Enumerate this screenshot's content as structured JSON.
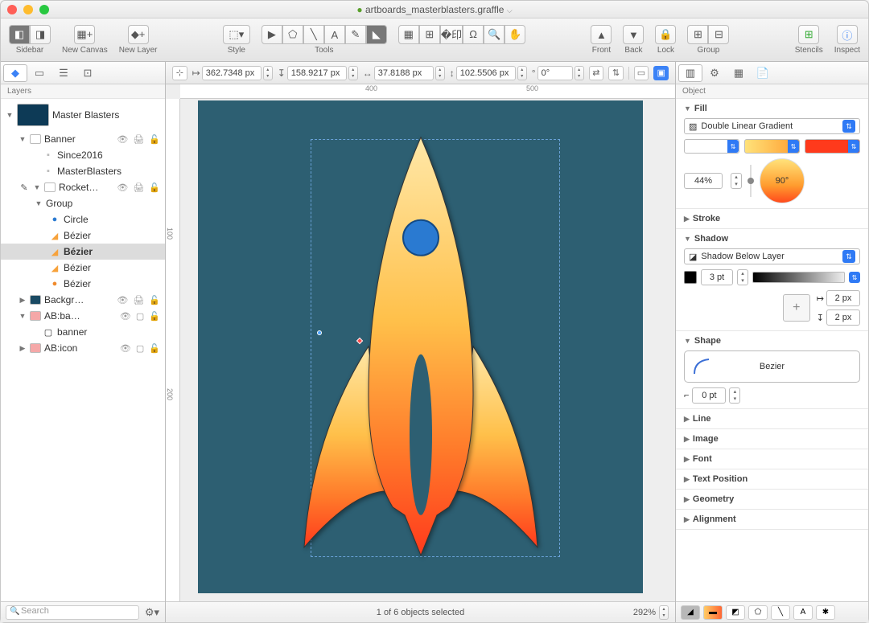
{
  "title": "artboards_masterblasters.graffle",
  "toolbar": {
    "sidebar": "Sidebar",
    "new_canvas": "New Canvas",
    "new_layer": "New Layer",
    "style": "Style",
    "tools": "Tools",
    "front": "Front",
    "back": "Back",
    "lock": "Lock",
    "group": "Group",
    "stencils": "Stencils",
    "inspect": "Inspect"
  },
  "geom": {
    "x": "362.7348 px",
    "y": "158.9217 px",
    "w": "37.8188 px",
    "h": "102.5506 px",
    "rot": "0°"
  },
  "ruler": {
    "h1": "400",
    "h2": "500",
    "v1": "100",
    "v2": "200"
  },
  "left": {
    "header": "Layers",
    "search_placeholder": "Search",
    "items": {
      "canvas": "Master Blasters",
      "banner": "Banner",
      "since": "Since2016",
      "mb": "MasterBlasters",
      "rocket": "Rocket…",
      "group": "Group",
      "circle": "Circle",
      "bez1": "Bézier",
      "bez2": "Bézier",
      "bez3": "Bézier",
      "bez4": "Bézier",
      "backgr": "Backgr…",
      "abba": "AB:ba…",
      "banner2": "banner",
      "abicon": "AB:icon"
    }
  },
  "status": {
    "selection": "1 of 6 objects selected",
    "zoom": "292%"
  },
  "insp": {
    "header": "Object",
    "fill": "Fill",
    "fill_type": "Double Linear Gradient",
    "fill_pos": "44%",
    "fill_angle": "90°",
    "stroke": "Stroke",
    "shadow": "Shadow",
    "shadow_type": "Shadow Below Layer",
    "shadow_blur": "3 pt",
    "shadow_x": "2 px",
    "shadow_y": "2 px",
    "shape": "Shape",
    "shape_name": "Bezier",
    "shape_radius": "0 pt",
    "line": "Line",
    "image": "Image",
    "font": "Font",
    "text_pos": "Text Position",
    "geometry": "Geometry",
    "alignment": "Alignment"
  }
}
